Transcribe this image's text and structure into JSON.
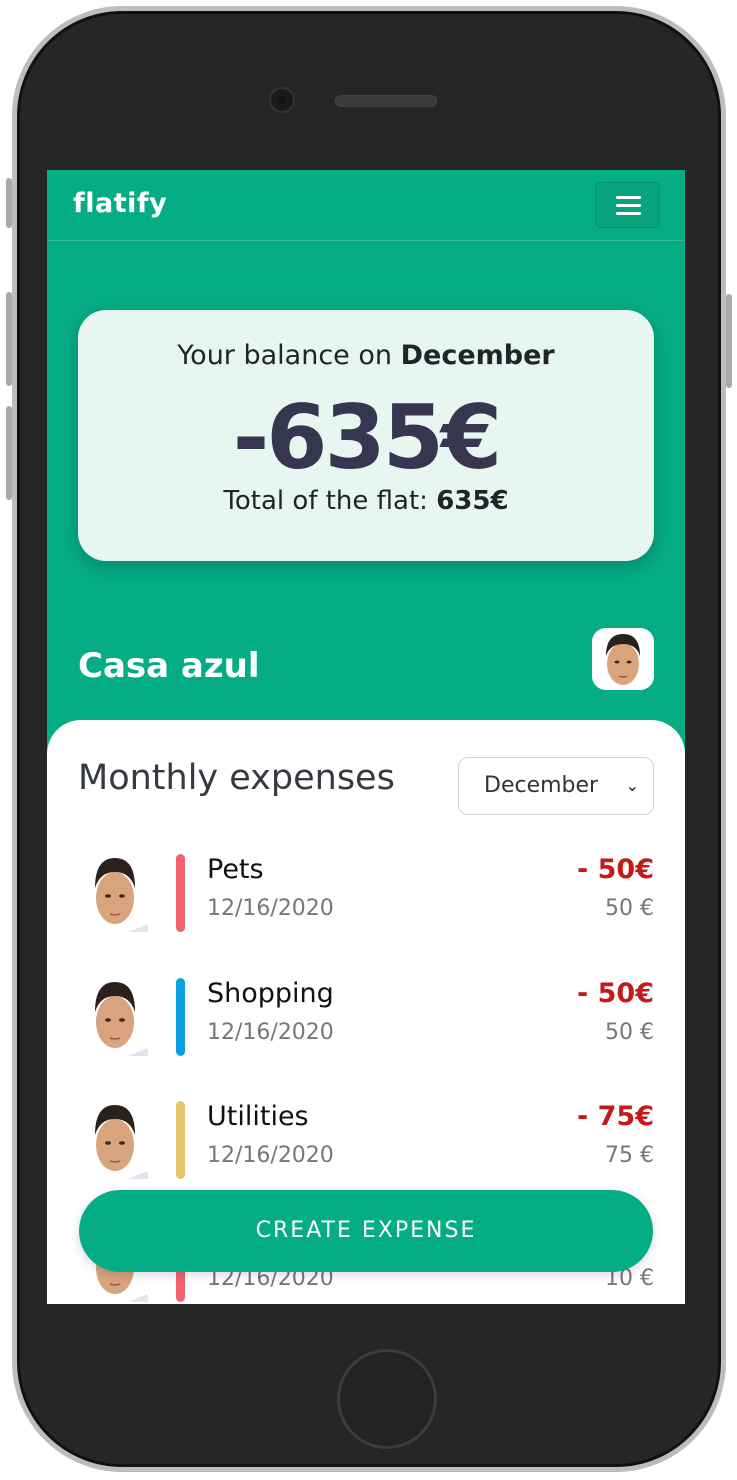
{
  "app": {
    "logo": "flatify"
  },
  "balance": {
    "title_prefix": "Your balance on ",
    "month": "December",
    "amount": "-635€",
    "total_label": "Total of the flat: ",
    "total_value": "635€"
  },
  "flat": {
    "name": "Casa azul"
  },
  "expenses": {
    "title": "Monthly expenses",
    "selected_month": "December",
    "items": [
      {
        "name": "Pets",
        "date": "12/16/2020",
        "amount": "- 50€",
        "share": "50 €",
        "color": "#f0636f"
      },
      {
        "name": "Shopping",
        "date": "12/16/2020",
        "amount": "- 50€",
        "share": "50 €",
        "color": "#0aa0e0"
      },
      {
        "name": "Utilities",
        "date": "12/16/2020",
        "amount": "- 75€",
        "share": "75 €",
        "color": "#e6c56b"
      },
      {
        "name": "",
        "date": "12/16/2020",
        "amount": "",
        "share": "10 €",
        "color": "#f0636f"
      }
    ]
  },
  "actions": {
    "create_label": "CREATE EXPENSE"
  },
  "colors": {
    "brand": "#05ad85",
    "negative": "#c41a1a",
    "balance_text": "#363650"
  }
}
